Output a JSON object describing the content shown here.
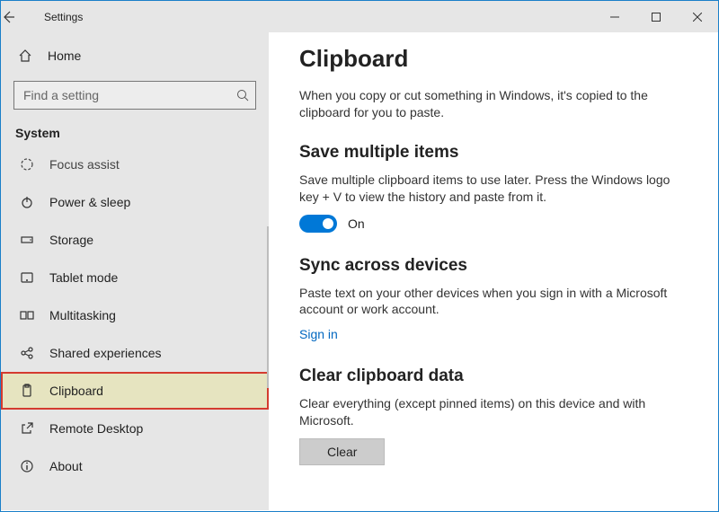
{
  "window": {
    "title": "Settings"
  },
  "sidebar": {
    "home": "Home",
    "search_placeholder": "Find a setting",
    "category": "System",
    "items": [
      {
        "label": "Focus assist",
        "icon": "focus"
      },
      {
        "label": "Power & sleep",
        "icon": "power"
      },
      {
        "label": "Storage",
        "icon": "storage"
      },
      {
        "label": "Tablet mode",
        "icon": "tablet"
      },
      {
        "label": "Multitasking",
        "icon": "multitask"
      },
      {
        "label": "Shared experiences",
        "icon": "shared"
      },
      {
        "label": "Clipboard",
        "icon": "clipboard"
      },
      {
        "label": "Remote Desktop",
        "icon": "remote"
      },
      {
        "label": "About",
        "icon": "about"
      }
    ]
  },
  "main": {
    "title": "Clipboard",
    "intro": "When you copy or cut something in Windows, it's copied to the clipboard for you to paste.",
    "sections": {
      "save": {
        "heading": "Save multiple items",
        "desc": "Save multiple clipboard items to use later. Press the Windows logo key + V to view the history and paste from it.",
        "toggle_state": "On"
      },
      "sync": {
        "heading": "Sync across devices",
        "desc": "Paste text on your other devices when you sign in with a Microsoft account or work account.",
        "link": "Sign in"
      },
      "clear": {
        "heading": "Clear clipboard data",
        "desc": "Clear everything (except pinned items) on this device and with Microsoft.",
        "button": "Clear"
      }
    }
  }
}
